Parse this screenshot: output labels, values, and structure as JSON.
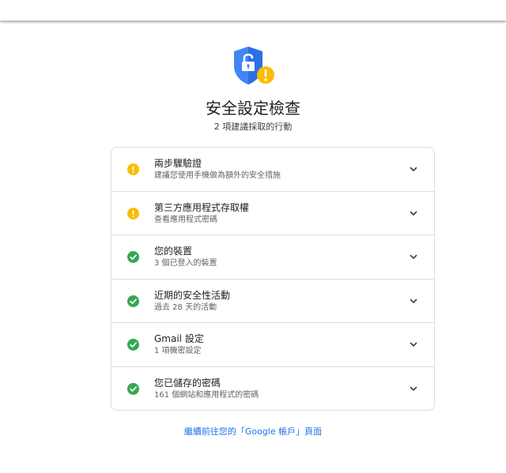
{
  "header": {
    "title": "安全設定檢查",
    "subtitle": "2 項建議採取的行動",
    "icon": "shield-lock-warning-icon"
  },
  "colors": {
    "warning": "#fbbc04",
    "ok": "#34a853",
    "link": "#1a73e8",
    "shield": "#4285f4"
  },
  "items": [
    {
      "title": "兩步驟驗證",
      "subtitle": "建議您使用手機做為額外的安全措施",
      "status": "warning"
    },
    {
      "title": "第三方應用程式存取權",
      "subtitle": "查看應用程式密碼",
      "status": "warning"
    },
    {
      "title": "您的裝置",
      "subtitle": "3 個已登入的裝置",
      "status": "ok"
    },
    {
      "title": "近期的安全性活動",
      "subtitle": "過去 28 天的活動",
      "status": "ok"
    },
    {
      "title": "Gmail 設定",
      "subtitle": "1 項機密設定",
      "status": "ok"
    },
    {
      "title": "您已儲存的密碼",
      "subtitle": "161 個網站和應用程式的密碼",
      "status": "ok"
    }
  ],
  "footer": {
    "link": "繼續前往您的「Google 帳戶」頁面"
  }
}
